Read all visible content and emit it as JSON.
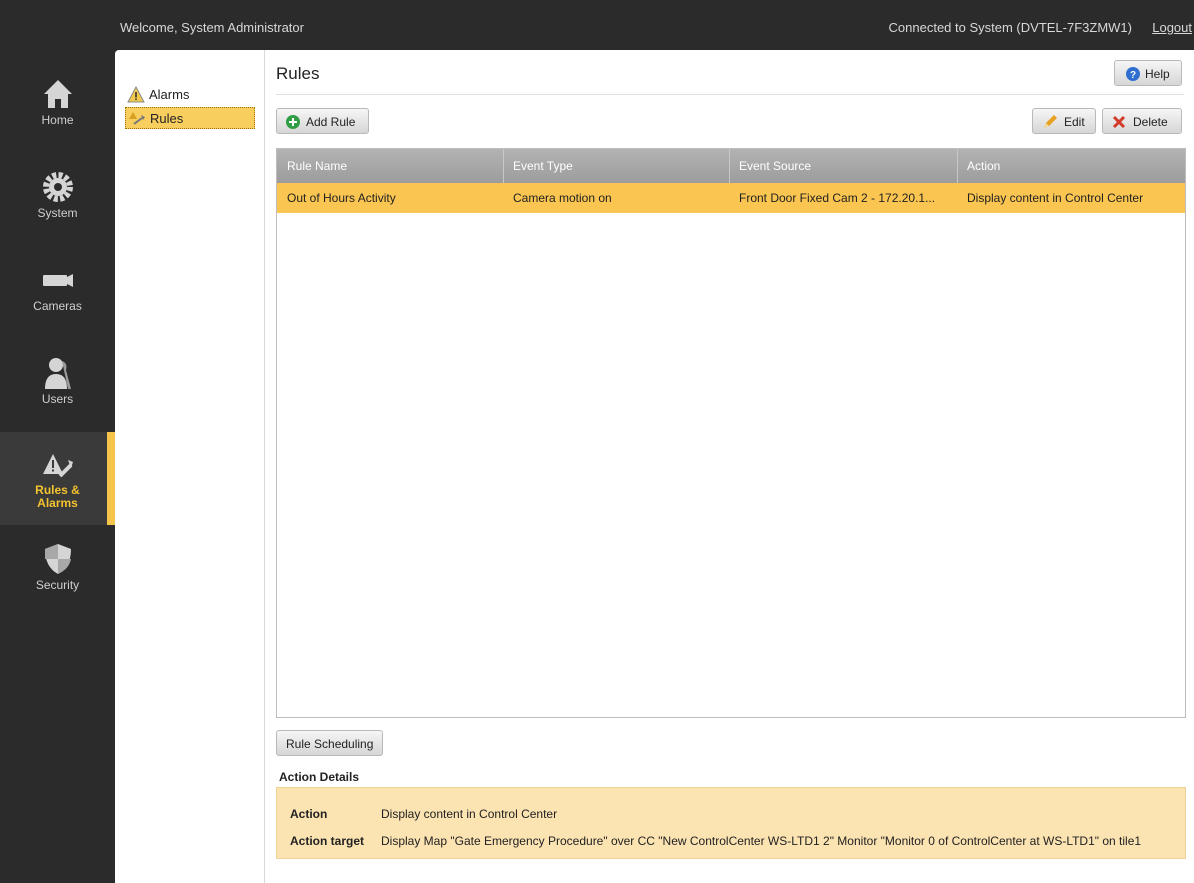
{
  "topbar": {
    "welcome": "Welcome, System Administrator",
    "connection": "Connected to System (DVTEL-7F3ZMW1)",
    "logout": "Logout"
  },
  "nav": {
    "items": [
      {
        "label": "Home",
        "icon": "home-icon"
      },
      {
        "label": "System",
        "icon": "gear-icon"
      },
      {
        "label": "Cameras",
        "icon": "camera-icon"
      },
      {
        "label": "Users",
        "icon": "user-icon"
      },
      {
        "label": "Rules &",
        "label2": "Alarms",
        "icon": "rules-alarms-icon",
        "active": true
      },
      {
        "label": "Security",
        "icon": "shield-icon"
      }
    ]
  },
  "tree": {
    "items": [
      {
        "label": "Alarms",
        "icon": "warning-icon"
      },
      {
        "label": "Rules",
        "icon": "rule-wand-icon",
        "selected": true
      }
    ]
  },
  "page": {
    "title": "Rules",
    "help": "Help",
    "add_rule": "Add Rule",
    "edit": "Edit",
    "delete": "Delete",
    "rule_scheduling": "Rule Scheduling"
  },
  "table": {
    "columns": [
      "Rule Name",
      "Event Type",
      "Event Source",
      "Action"
    ],
    "rows": [
      [
        "Out of Hours Activity",
        "Camera motion on",
        "Front Door Fixed Cam 2 - 172.20.1...",
        "Display content in Control Center"
      ]
    ]
  },
  "details": {
    "heading": "Action Details",
    "action_key": "Action",
    "action_value": "Display content in Control Center",
    "target_key": "Action target",
    "target_value": "Display Map \"Gate Emergency Procedure\" over CC \"New ControlCenter WS-LTD1 2\" Monitor \"Monitor 0 of ControlCenter at WS-LTD1\" on tile1"
  },
  "colors": {
    "accent": "#f5c44a",
    "selected_row": "#fac550",
    "details_bg": "#fbe3b2",
    "nav_bg": "#2b2b2b"
  }
}
